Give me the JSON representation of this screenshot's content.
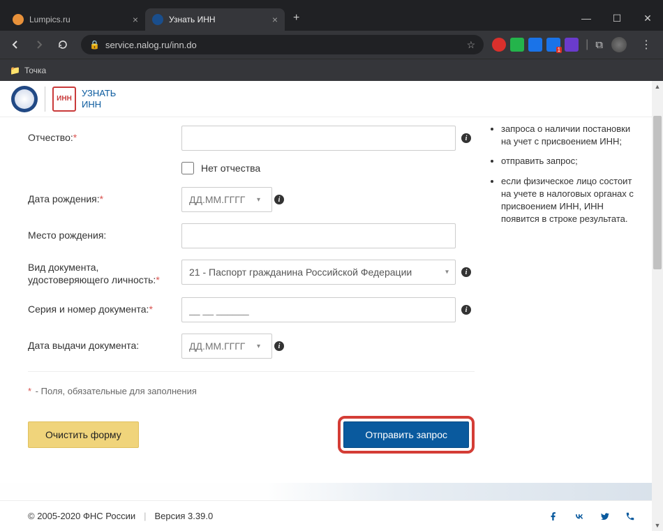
{
  "browser": {
    "tabs": [
      {
        "title": "Lumpics.ru",
        "icon_color": "#e8913a"
      },
      {
        "title": "Узнать ИНН",
        "icon_color": "#1a4e8c"
      }
    ],
    "url": "service.nalog.ru/inn.do"
  },
  "bookmarks": {
    "folder_label": "Точка"
  },
  "header": {
    "badge_text": "ИНН",
    "title_line1": "УЗНАТЬ",
    "title_line2": "ИНН"
  },
  "form": {
    "patronymic_label": "Отчество:",
    "no_patronymic_label": "Нет отчества",
    "dob_label": "Дата рождения:",
    "dob_placeholder": "ДД.ММ.ГГГГ",
    "pob_label": "Место рождения:",
    "doc_type_label": "Вид документа, удостоверяющего личность:",
    "doc_type_value": "21 - Паспорт гражданина Российской Федерации",
    "doc_num_label": "Серия и номер документа:",
    "doc_num_placeholder": "__ __ ______",
    "issue_date_label": "Дата выдачи документа:",
    "issue_date_placeholder": "ДД.ММ.ГГГГ",
    "required_hint": " - Поля, обязательные для заполнения",
    "btn_clear": "Очистить форму",
    "btn_submit": "Отправить запрос"
  },
  "sidebar": {
    "items": [
      "запроса о наличии постановки на учет с присвоением ИНН;",
      "отправить запрос;",
      "если физическое лицо состоит на учете в налоговых органах с присвоением ИНН, ИНН появится в строке результата."
    ]
  },
  "footer": {
    "copyright": "© 2005-2020 ФНС России",
    "version": "Версия 3.39.0"
  }
}
